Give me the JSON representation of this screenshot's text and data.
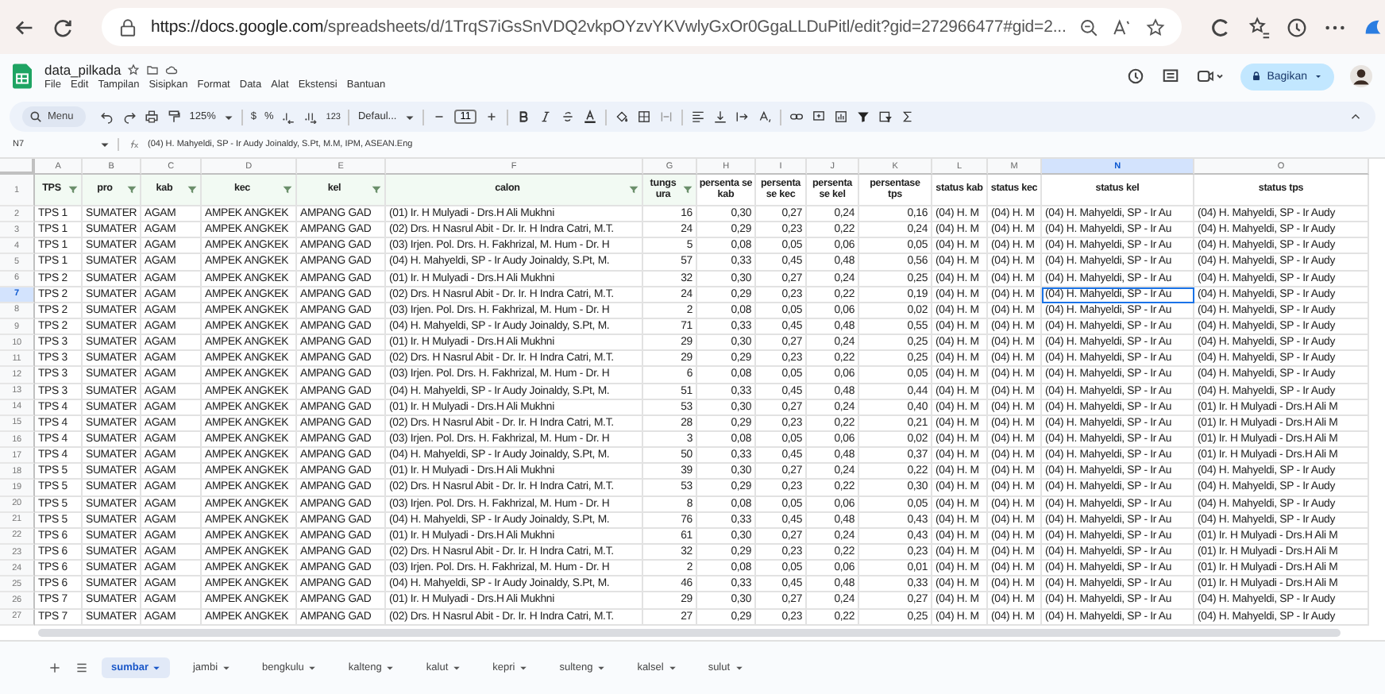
{
  "browser": {
    "url_host": "https://docs.google.com",
    "url_path": "/spreadsheets/d/1TrqS7iGsSnVDQ2vkpOYzvYKVwlyGxOr0GgaLLDuPitl/edit?gid=272966477#gid=2..."
  },
  "document": {
    "title": "data_pilkada",
    "menus": [
      "File",
      "Edit",
      "Tampilan",
      "Sisipkan",
      "Format",
      "Data",
      "Alat",
      "Ekstensi",
      "Bantuan"
    ],
    "share_button": "Bagikan"
  },
  "toolbar": {
    "search": "Menu",
    "zoom": "125%",
    "currency": "$",
    "percent": "%",
    "number_format": "123",
    "font": "Defaul...",
    "font_size": "11"
  },
  "formula_bar": {
    "cell_ref": "N7",
    "formula": "(04) H. Mahyeldi, SP - Ir Audy Joinaldy, S.Pt, M.M, IPM, ASEAN.Eng"
  },
  "sheet": {
    "columns": [
      {
        "letter": "A",
        "selected": false
      },
      {
        "letter": "B",
        "selected": false
      },
      {
        "letter": "C",
        "selected": false
      },
      {
        "letter": "D",
        "selected": false
      },
      {
        "letter": "E",
        "selected": false
      },
      {
        "letter": "F",
        "selected": false
      },
      {
        "letter": "G",
        "selected": false
      },
      {
        "letter": "H",
        "selected": false
      },
      {
        "letter": "I",
        "selected": false
      },
      {
        "letter": "J",
        "selected": false
      },
      {
        "letter": "K",
        "selected": false
      },
      {
        "letter": "L",
        "selected": false
      },
      {
        "letter": "M",
        "selected": false
      },
      {
        "letter": "N",
        "selected": true
      },
      {
        "letter": "O",
        "selected": false
      }
    ],
    "header": {
      "num": "1",
      "cells": [
        {
          "text": "TPS",
          "filter": true
        },
        {
          "text": "pro",
          "filter": true
        },
        {
          "text": "kab",
          "filter": true
        },
        {
          "text": "kec",
          "filter": true
        },
        {
          "text": "kel",
          "filter": true
        },
        {
          "text": "calon",
          "filter": true
        },
        {
          "text": "tungs ura",
          "filter": true
        },
        {
          "text": "persenta se kab",
          "filter": false
        },
        {
          "text": "persenta se kec",
          "filter": false
        },
        {
          "text": "persenta se kel",
          "filter": false
        },
        {
          "text": "persentase tps",
          "filter": false
        },
        {
          "text": "status kab",
          "filter": false
        },
        {
          "text": "status kec",
          "filter": false
        },
        {
          "text": "status kel",
          "filter": false
        },
        {
          "text": "status tps",
          "filter": false
        }
      ]
    },
    "rows": [
      {
        "num": "2",
        "selected": false,
        "cells": [
          "TPS 1",
          "SUMATER",
          "AGAM",
          "AMPEK ANGKEK",
          "AMPANG GAD",
          "(01) Ir. H Mulyadi - Drs.H Ali Mukhni",
          "16",
          "0,30",
          "0,27",
          "0,24",
          "0,16",
          "(04) H. M",
          "(04) H. M",
          "(04) H. Mahyeldi, SP - Ir Au",
          "(04) H. Mahyeldi, SP - Ir Audy"
        ]
      },
      {
        "num": "3",
        "selected": false,
        "cells": [
          "TPS 1",
          "SUMATER",
          "AGAM",
          "AMPEK ANGKEK",
          "AMPANG GAD",
          "(02) Drs. H Nasrul Abit - Dr. Ir. H Indra Catri, M.T.",
          "24",
          "0,29",
          "0,23",
          "0,22",
          "0,24",
          "(04) H. M",
          "(04) H. M",
          "(04) H. Mahyeldi, SP - Ir Au",
          "(04) H. Mahyeldi, SP - Ir Audy"
        ]
      },
      {
        "num": "4",
        "selected": false,
        "cells": [
          "TPS 1",
          "SUMATER",
          "AGAM",
          "AMPEK ANGKEK",
          "AMPANG GAD",
          "(03) Irjen. Pol. Drs. H. Fakhrizal, M. Hum - Dr. H",
          "5",
          "0,08",
          "0,05",
          "0,06",
          "0,05",
          "(04) H. M",
          "(04) H. M",
          "(04) H. Mahyeldi, SP - Ir Au",
          "(04) H. Mahyeldi, SP - Ir Audy"
        ]
      },
      {
        "num": "5",
        "selected": false,
        "cells": [
          "TPS 1",
          "SUMATER",
          "AGAM",
          "AMPEK ANGKEK",
          "AMPANG GAD",
          "(04) H. Mahyeldi, SP - Ir Audy Joinaldy, S.Pt, M.",
          "57",
          "0,33",
          "0,45",
          "0,48",
          "0,56",
          "(04) H. M",
          "(04) H. M",
          "(04) H. Mahyeldi, SP - Ir Au",
          "(04) H. Mahyeldi, SP - Ir Audy"
        ]
      },
      {
        "num": "6",
        "selected": false,
        "cells": [
          "TPS 2",
          "SUMATER",
          "AGAM",
          "AMPEK ANGKEK",
          "AMPANG GAD",
          "(01) Ir. H Mulyadi - Drs.H Ali Mukhni",
          "32",
          "0,30",
          "0,27",
          "0,24",
          "0,25",
          "(04) H. M",
          "(04) H. M",
          "(04) H. Mahyeldi, SP - Ir Au",
          "(04) H. Mahyeldi, SP - Ir Audy"
        ]
      },
      {
        "num": "7",
        "selected": true,
        "cells": [
          "TPS 2",
          "SUMATER",
          "AGAM",
          "AMPEK ANGKEK",
          "AMPANG GAD",
          "(02) Drs. H Nasrul Abit - Dr. Ir. H Indra Catri, M.T.",
          "24",
          "0,29",
          "0,23",
          "0,22",
          "0,19",
          "(04) H. M",
          "(04) H. M",
          "(04) H. Mahyeldi, SP - Ir Au",
          "(04) H. Mahyeldi, SP - Ir Audy"
        ]
      },
      {
        "num": "8",
        "selected": false,
        "cells": [
          "TPS 2",
          "SUMATER",
          "AGAM",
          "AMPEK ANGKEK",
          "AMPANG GAD",
          "(03) Irjen. Pol. Drs. H. Fakhrizal, M. Hum - Dr. H",
          "2",
          "0,08",
          "0,05",
          "0,06",
          "0,02",
          "(04) H. M",
          "(04) H. M",
          "(04) H. Mahyeldi, SP - Ir Au",
          "(04) H. Mahyeldi, SP - Ir Audy"
        ]
      },
      {
        "num": "9",
        "selected": false,
        "cells": [
          "TPS 2",
          "SUMATER",
          "AGAM",
          "AMPEK ANGKEK",
          "AMPANG GAD",
          "(04) H. Mahyeldi, SP - Ir Audy Joinaldy, S.Pt, M.",
          "71",
          "0,33",
          "0,45",
          "0,48",
          "0,55",
          "(04) H. M",
          "(04) H. M",
          "(04) H. Mahyeldi, SP - Ir Au",
          "(04) H. Mahyeldi, SP - Ir Audy"
        ]
      },
      {
        "num": "10",
        "selected": false,
        "cells": [
          "TPS 3",
          "SUMATER",
          "AGAM",
          "AMPEK ANGKEK",
          "AMPANG GAD",
          "(01) Ir. H Mulyadi - Drs.H Ali Mukhni",
          "29",
          "0,30",
          "0,27",
          "0,24",
          "0,25",
          "(04) H. M",
          "(04) H. M",
          "(04) H. Mahyeldi, SP - Ir Au",
          "(04) H. Mahyeldi, SP - Ir Audy"
        ]
      },
      {
        "num": "11",
        "selected": false,
        "cells": [
          "TPS 3",
          "SUMATER",
          "AGAM",
          "AMPEK ANGKEK",
          "AMPANG GAD",
          "(02) Drs. H Nasrul Abit - Dr. Ir. H Indra Catri, M.T.",
          "29",
          "0,29",
          "0,23",
          "0,22",
          "0,25",
          "(04) H. M",
          "(04) H. M",
          "(04) H. Mahyeldi, SP - Ir Au",
          "(04) H. Mahyeldi, SP - Ir Audy"
        ]
      },
      {
        "num": "12",
        "selected": false,
        "cells": [
          "TPS 3",
          "SUMATER",
          "AGAM",
          "AMPEK ANGKEK",
          "AMPANG GAD",
          "(03) Irjen. Pol. Drs. H. Fakhrizal, M. Hum - Dr. H",
          "6",
          "0,08",
          "0,05",
          "0,06",
          "0,05",
          "(04) H. M",
          "(04) H. M",
          "(04) H. Mahyeldi, SP - Ir Au",
          "(04) H. Mahyeldi, SP - Ir Audy"
        ]
      },
      {
        "num": "13",
        "selected": false,
        "cells": [
          "TPS 3",
          "SUMATER",
          "AGAM",
          "AMPEK ANGKEK",
          "AMPANG GAD",
          "(04) H. Mahyeldi, SP - Ir Audy Joinaldy, S.Pt, M.",
          "51",
          "0,33",
          "0,45",
          "0,48",
          "0,44",
          "(04) H. M",
          "(04) H. M",
          "(04) H. Mahyeldi, SP - Ir Au",
          "(04) H. Mahyeldi, SP - Ir Audy"
        ]
      },
      {
        "num": "14",
        "selected": false,
        "cells": [
          "TPS 4",
          "SUMATER",
          "AGAM",
          "AMPEK ANGKEK",
          "AMPANG GAD",
          "(01) Ir. H Mulyadi - Drs.H Ali Mukhni",
          "53",
          "0,30",
          "0,27",
          "0,24",
          "0,40",
          "(04) H. M",
          "(04) H. M",
          "(04) H. Mahyeldi, SP - Ir Au",
          "(01) Ir. H Mulyadi - Drs.H Ali M"
        ]
      },
      {
        "num": "15",
        "selected": false,
        "cells": [
          "TPS 4",
          "SUMATER",
          "AGAM",
          "AMPEK ANGKEK",
          "AMPANG GAD",
          "(02) Drs. H Nasrul Abit - Dr. Ir. H Indra Catri, M.T.",
          "28",
          "0,29",
          "0,23",
          "0,22",
          "0,21",
          "(04) H. M",
          "(04) H. M",
          "(04) H. Mahyeldi, SP - Ir Au",
          "(01) Ir. H Mulyadi - Drs.H Ali M"
        ]
      },
      {
        "num": "16",
        "selected": false,
        "cells": [
          "TPS 4",
          "SUMATER",
          "AGAM",
          "AMPEK ANGKEK",
          "AMPANG GAD",
          "(03) Irjen. Pol. Drs. H. Fakhrizal, M. Hum - Dr. H",
          "3",
          "0,08",
          "0,05",
          "0,06",
          "0,02",
          "(04) H. M",
          "(04) H. M",
          "(04) H. Mahyeldi, SP - Ir Au",
          "(01) Ir. H Mulyadi - Drs.H Ali M"
        ]
      },
      {
        "num": "17",
        "selected": false,
        "cells": [
          "TPS 4",
          "SUMATER",
          "AGAM",
          "AMPEK ANGKEK",
          "AMPANG GAD",
          "(04) H. Mahyeldi, SP - Ir Audy Joinaldy, S.Pt, M.",
          "50",
          "0,33",
          "0,45",
          "0,48",
          "0,37",
          "(04) H. M",
          "(04) H. M",
          "(04) H. Mahyeldi, SP - Ir Au",
          "(01) Ir. H Mulyadi - Drs.H Ali M"
        ]
      },
      {
        "num": "18",
        "selected": false,
        "cells": [
          "TPS 5",
          "SUMATER",
          "AGAM",
          "AMPEK ANGKEK",
          "AMPANG GAD",
          "(01) Ir. H Mulyadi - Drs.H Ali Mukhni",
          "39",
          "0,30",
          "0,27",
          "0,24",
          "0,22",
          "(04) H. M",
          "(04) H. M",
          "(04) H. Mahyeldi, SP - Ir Au",
          "(04) H. Mahyeldi, SP - Ir Audy"
        ]
      },
      {
        "num": "19",
        "selected": false,
        "cells": [
          "TPS 5",
          "SUMATER",
          "AGAM",
          "AMPEK ANGKEK",
          "AMPANG GAD",
          "(02) Drs. H Nasrul Abit - Dr. Ir. H Indra Catri, M.T.",
          "53",
          "0,29",
          "0,23",
          "0,22",
          "0,30",
          "(04) H. M",
          "(04) H. M",
          "(04) H. Mahyeldi, SP - Ir Au",
          "(04) H. Mahyeldi, SP - Ir Audy"
        ]
      },
      {
        "num": "20",
        "selected": false,
        "cells": [
          "TPS 5",
          "SUMATER",
          "AGAM",
          "AMPEK ANGKEK",
          "AMPANG GAD",
          "(03) Irjen. Pol. Drs. H. Fakhrizal, M. Hum - Dr. H",
          "8",
          "0,08",
          "0,05",
          "0,06",
          "0,05",
          "(04) H. M",
          "(04) H. M",
          "(04) H. Mahyeldi, SP - Ir Au",
          "(04) H. Mahyeldi, SP - Ir Audy"
        ]
      },
      {
        "num": "21",
        "selected": false,
        "cells": [
          "TPS 5",
          "SUMATER",
          "AGAM",
          "AMPEK ANGKEK",
          "AMPANG GAD",
          "(04) H. Mahyeldi, SP - Ir Audy Joinaldy, S.Pt, M.",
          "76",
          "0,33",
          "0,45",
          "0,48",
          "0,43",
          "(04) H. M",
          "(04) H. M",
          "(04) H. Mahyeldi, SP - Ir Au",
          "(04) H. Mahyeldi, SP - Ir Audy"
        ]
      },
      {
        "num": "22",
        "selected": false,
        "cells": [
          "TPS 6",
          "SUMATER",
          "AGAM",
          "AMPEK ANGKEK",
          "AMPANG GAD",
          "(01) Ir. H Mulyadi - Drs.H Ali Mukhni",
          "61",
          "0,30",
          "0,27",
          "0,24",
          "0,43",
          "(04) H. M",
          "(04) H. M",
          "(04) H. Mahyeldi, SP - Ir Au",
          "(01) Ir. H Mulyadi - Drs.H Ali M"
        ]
      },
      {
        "num": "23",
        "selected": false,
        "cells": [
          "TPS 6",
          "SUMATER",
          "AGAM",
          "AMPEK ANGKEK",
          "AMPANG GAD",
          "(02) Drs. H Nasrul Abit - Dr. Ir. H Indra Catri, M.T.",
          "32",
          "0,29",
          "0,23",
          "0,22",
          "0,23",
          "(04) H. M",
          "(04) H. M",
          "(04) H. Mahyeldi, SP - Ir Au",
          "(01) Ir. H Mulyadi - Drs.H Ali M"
        ]
      },
      {
        "num": "24",
        "selected": false,
        "cells": [
          "TPS 6",
          "SUMATER",
          "AGAM",
          "AMPEK ANGKEK",
          "AMPANG GAD",
          "(03) Irjen. Pol. Drs. H. Fakhrizal, M. Hum - Dr. H",
          "2",
          "0,08",
          "0,05",
          "0,06",
          "0,01",
          "(04) H. M",
          "(04) H. M",
          "(04) H. Mahyeldi, SP - Ir Au",
          "(01) Ir. H Mulyadi - Drs.H Ali M"
        ]
      },
      {
        "num": "25",
        "selected": false,
        "cells": [
          "TPS 6",
          "SUMATER",
          "AGAM",
          "AMPEK ANGKEK",
          "AMPANG GAD",
          "(04) H. Mahyeldi, SP - Ir Audy Joinaldy, S.Pt, M.",
          "46",
          "0,33",
          "0,45",
          "0,48",
          "0,33",
          "(04) H. M",
          "(04) H. M",
          "(04) H. Mahyeldi, SP - Ir Au",
          "(01) Ir. H Mulyadi - Drs.H Ali M"
        ]
      },
      {
        "num": "26",
        "selected": false,
        "cells": [
          "TPS 7",
          "SUMATER",
          "AGAM",
          "AMPEK ANGKEK",
          "AMPANG GAD",
          "(01) Ir. H Mulyadi - Drs.H Ali Mukhni",
          "29",
          "0,30",
          "0,27",
          "0,24",
          "0,27",
          "(04) H. M",
          "(04) H. M",
          "(04) H. Mahyeldi, SP - Ir Au",
          "(04) H. Mahyeldi, SP - Ir Audy"
        ]
      },
      {
        "num": "27",
        "selected": false,
        "cells": [
          "TPS 7",
          "SUMATER",
          "AGAM",
          "AMPEK ANGKEK",
          "AMPANG GAD",
          "(02) Drs. H Nasrul Abit - Dr. Ir. H Indra Catri, M.T.",
          "27",
          "0,29",
          "0,23",
          "0,22",
          "0,25",
          "(04) H. M",
          "(04) H. M",
          "(04) H. Mahyeldi, SP - Ir Au",
          "(04) H. Mahyeldi, SP - Ir Audy"
        ]
      }
    ]
  },
  "sheet_tabs": [
    {
      "label": "sumbar",
      "selected": true
    },
    {
      "label": "jambi",
      "selected": false
    },
    {
      "label": "bengkulu",
      "selected": false
    },
    {
      "label": "kalteng",
      "selected": false
    },
    {
      "label": "kalut",
      "selected": false
    },
    {
      "label": "kepri",
      "selected": false
    },
    {
      "label": "sulteng",
      "selected": false
    },
    {
      "label": "kalsel",
      "selected": false
    },
    {
      "label": "sulut",
      "selected": false
    }
  ]
}
